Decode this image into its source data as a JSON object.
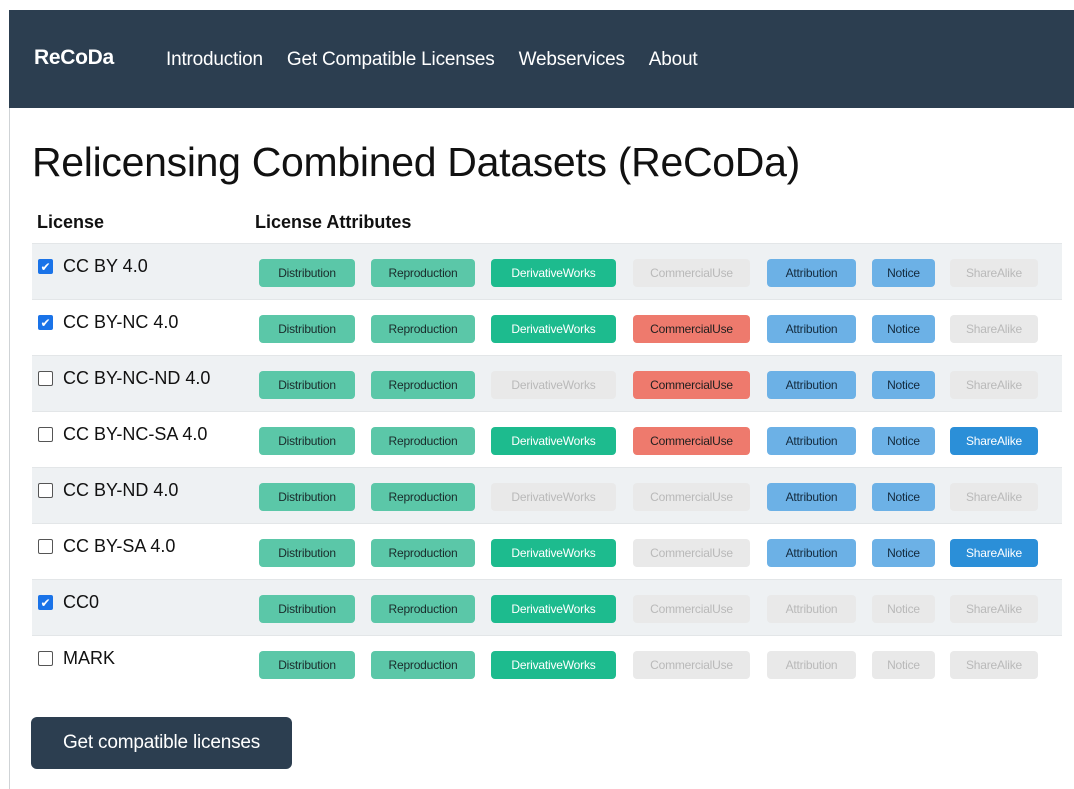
{
  "navbar": {
    "brand": "ReCoDa",
    "links": [
      "Introduction",
      "Get Compatible Licenses",
      "Webservices",
      "About"
    ]
  },
  "page_title": "Relicensing Combined Datasets (ReCoDa)",
  "table": {
    "headers": {
      "license": "License",
      "attributes": "License Attributes"
    },
    "attribute_names": [
      "Distribution",
      "Reproduction",
      "DerivativeWorks",
      "CommercialUse",
      "Attribution",
      "Notice",
      "ShareAlike"
    ],
    "rows": [
      {
        "license": "CC BY 4.0",
        "checked": true,
        "active": [
          true,
          true,
          true,
          false,
          true,
          true,
          false
        ]
      },
      {
        "license": "CC BY-NC 4.0",
        "checked": true,
        "active": [
          true,
          true,
          true,
          true,
          true,
          true,
          false
        ]
      },
      {
        "license": "CC BY-NC-ND 4.0",
        "checked": false,
        "active": [
          true,
          true,
          false,
          true,
          true,
          true,
          false
        ]
      },
      {
        "license": "CC BY-NC-SA 4.0",
        "checked": false,
        "active": [
          true,
          true,
          true,
          true,
          true,
          true,
          true
        ]
      },
      {
        "license": "CC BY-ND 4.0",
        "checked": false,
        "active": [
          true,
          true,
          false,
          false,
          true,
          true,
          false
        ]
      },
      {
        "license": "CC BY-SA 4.0",
        "checked": false,
        "active": [
          true,
          true,
          true,
          false,
          true,
          true,
          true
        ]
      },
      {
        "license": "CC0",
        "checked": true,
        "active": [
          true,
          true,
          true,
          false,
          false,
          false,
          false
        ]
      },
      {
        "license": "MARK",
        "checked": false,
        "active": [
          true,
          true,
          true,
          false,
          false,
          false,
          false
        ]
      }
    ]
  },
  "submit_button": "Get compatible licenses",
  "colors": {
    "navbar": "#2c3e50",
    "distribution_reproduction": "#5bc7a8",
    "derivative_works": "#1dbb8e",
    "commercial_use": "#ee7a6d",
    "attribution_notice": "#6cb1e6",
    "share_alike": "#2b8fd8",
    "inactive": "#e9e9e9",
    "checkbox_checked": "#1a73e8"
  }
}
